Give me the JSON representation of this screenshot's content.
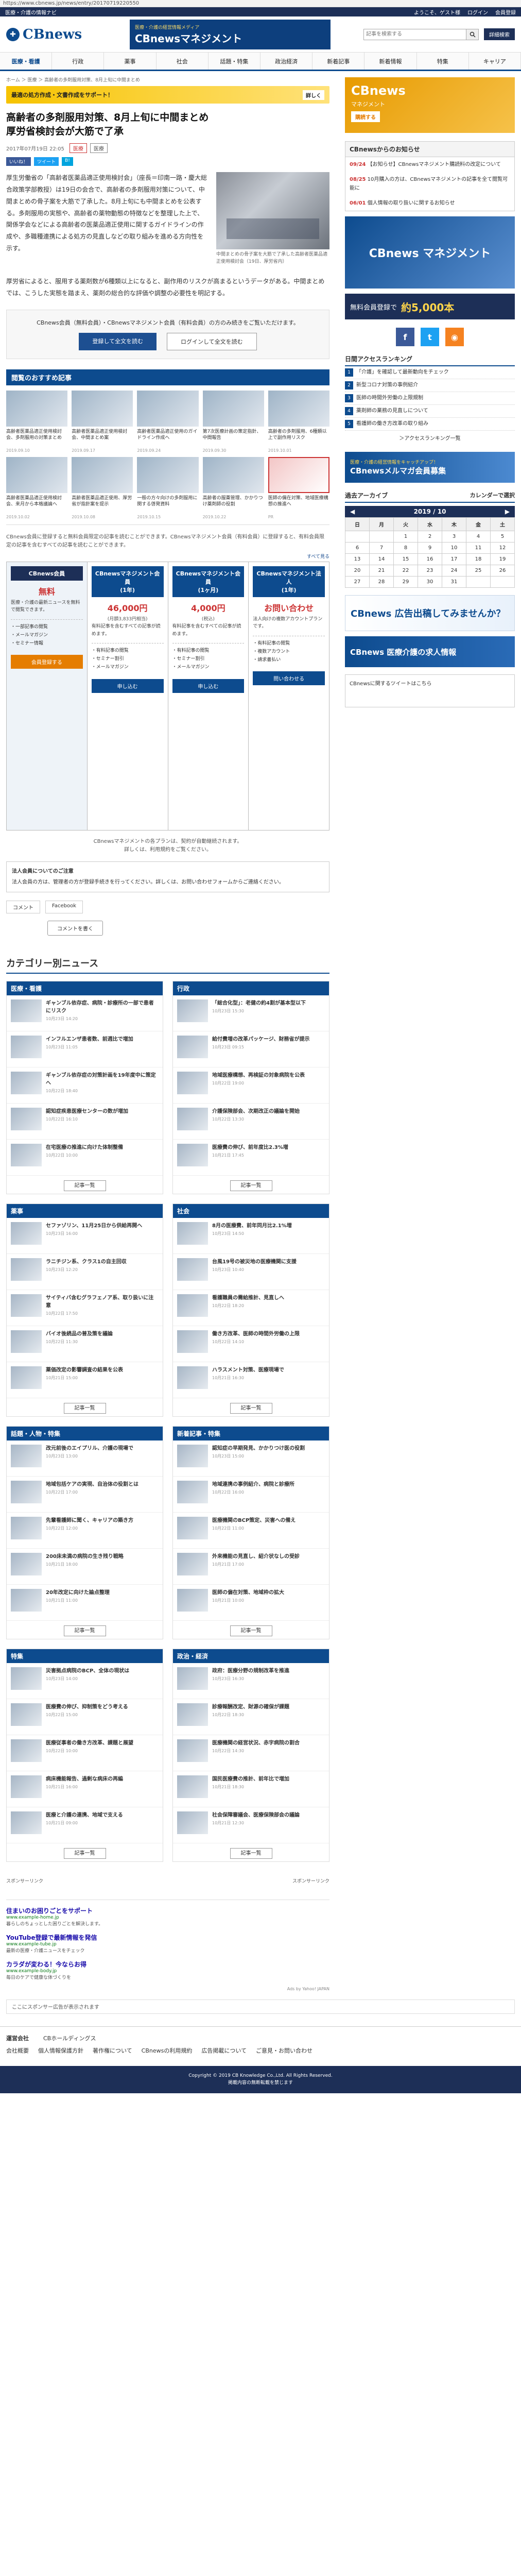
{
  "browser": {
    "url": "https://www.cbnews.jp/news/entry/20170719220550"
  },
  "util_bar": {
    "home": "医療・介護の情報ナビ",
    "welcome": "ようこそ、ゲスト様",
    "login": "ログイン",
    "register": "会員登録"
  },
  "masthead": {
    "logo_text": "CBnews",
    "banner_small": "医療・介護の経営情報メディア",
    "banner_big": "CBnewsマネジメント",
    "search_placeholder": "記事を検索する",
    "register_button": "詳細検索"
  },
  "gnav": [
    "医療・看護",
    "行政",
    "薬事",
    "社会",
    "話題・特集",
    "政治経済",
    "新着記事",
    "新着情報",
    "特集",
    "キャリア"
  ],
  "breadcrumb": "ホーム ＞ 医療 ＞ 高齢者の多剤服用対策、8月上旬に中間まとめ",
  "promo": {
    "text": "最適の処方作成・文書作成をサポート！",
    "button": "詳しく"
  },
  "article": {
    "title": "高齢者の多剤服用対策、8月上旬に中間まとめ\n厚労省検討会が大筋で了承",
    "date": "2017年07月19日 22:05",
    "category": "医療",
    "tag": "医療",
    "share": [
      "いいね！",
      "ツイート",
      "B!"
    ],
    "body1": "厚生労働省の「高齢者医薬品適正使用検討会」（座長＝印南一路・慶大総合政策学部教授）は19日の会合で、高齢者の多剤服用対策について、中間まとめの骨子案を大筋で了承した。8月上旬にも中間まとめを公表する。多剤服用の実態や、高齢者の薬物動態の特徴などを整理した上で、関係学会などによる高齢者の医薬品適正使用に関するガイドラインの作成や、多職種連携による処方の見直しなどの取り組みを進める方向性を示す。",
    "photo_caption": "中間まとめの骨子案を大筋で了承した高齢者医薬品適正使用検討会（19日、厚労省内）",
    "body2": "厚労省によると、服用する薬剤数が6種類以上になると、副作用のリスクが高まるというデータがある。中間まとめでは、こうした実態を踏まえ、薬剤の総合的な評価や調整の必要性を明記する。",
    "member_note": "CBnews会員（無料会員）・CBnewsマネジメント会員（有料会員）の方のみ続きをご覧いただけます。",
    "btn_register": "登録して全文を読む",
    "btn_login": "ログインして全文を読む"
  },
  "recommend": {
    "heading": "閲覧のおすすめ記事",
    "items": [
      {
        "title": "高齢者医薬品適正使用検討会、多剤服用の対策まとめ",
        "date": "2019.09.10"
      },
      {
        "title": "高齢者医薬品適正使用検討会、中間まとめ案",
        "date": "2019.09.17"
      },
      {
        "title": "高齢者医薬品適正使用のガイドライン作成へ",
        "date": "2019.09.24"
      },
      {
        "title": "第7次医療計画の策定指針、中間報告",
        "date": "2019.09.30"
      },
      {
        "title": "高齢者の多剤服用、6種類以上で副作用リスク",
        "date": "2019.10.01"
      },
      {
        "title": "高齢者医薬品適正使用検討会、来月から本格議論へ",
        "date": "2019.10.02"
      },
      {
        "title": "高齢者医薬品適正使用、厚労省が指針案を提示",
        "date": "2019.10.08"
      },
      {
        "title": "一般の方々向けの多剤服用に関する啓発資料",
        "date": "2019.10.15"
      },
      {
        "title": "高齢者の服薬管理、かかりつけ薬剤師の役割",
        "date": "2019.10.22"
      },
      {
        "title": "医師の偏在対策、地域医療構想の推進へ",
        "date": "PR"
      }
    ]
  },
  "plans": {
    "note": "CBnews会員に登録すると無料会員限定の記事を読むことができます。CBnewsマネジメント会員（有料会員）に登録すると、有料会員限定の記事を含むすべての記事を読むことができます。",
    "link": "すべて見る",
    "columns": [
      {
        "name": "CBnews会員",
        "price": "無料",
        "sub": "",
        "desc": "医療・介護の最新ニュースを無料で閲覧できます。",
        "features": "・一部記事の閲覧\n・メールマガジン\n・セミナー情報",
        "button": "会員登録する"
      },
      {
        "name": "CBnewsマネジメント会員\n(1年)",
        "price": "46,000円",
        "sub": "(月額3,833円相当)",
        "desc": "有料記事を含むすべての記事が読めます。",
        "features": "・有料記事の閲覧\n・セミナー割引\n・メールマガジン",
        "button": "申し込む"
      },
      {
        "name": "CBnewsマネジメント会員\n(1ヶ月)",
        "price": "4,000円",
        "sub": "(税込)",
        "desc": "有料記事を含むすべての記事が読めます。",
        "features": "・有料記事の閲覧\n・セミナー割引\n・メールマガジン",
        "button": "申し込む"
      },
      {
        "name": "CBnewsマネジメント法人\n(1年)",
        "price": "お問い合わせ",
        "sub": "",
        "desc": "法人向けの複数アカウントプランです。",
        "features": "・有料記事の閲覧\n・複数アカウント\n・請求書払い",
        "button": "問い合わせる"
      }
    ],
    "footnote": "CBnewsマネジメントの各プランは、契約が自動継続されます。\n詳しくは、利用規約をご覧ください。"
  },
  "notice": {
    "heading": "法人会員についてのご注意",
    "text": "法人会員の方は、管理者の方が登録手続きを行ってください。詳しくは、お問い合わせフォームからご連絡ください。"
  },
  "social": {
    "comment": "コメント",
    "facebook": "Facebook",
    "comment_btn": "コメントを書く"
  },
  "category_news": {
    "title": "カテゴリー別ニュース",
    "boxes": [
      {
        "head": "医療・看護",
        "items": [
          {
            "t": "ギャンブル依存症、病院・診療所の一部で患者にリスク",
            "d": "10月23日 14:20"
          },
          {
            "t": "インフルエンザ患者数、前週比で増加",
            "d": "10月23日 11:05"
          },
          {
            "t": "ギャンブル依存症の対策計画を19年度中に策定へ",
            "d": "10月22日 18:40"
          },
          {
            "t": "認知症疾患医療センターの数が増加",
            "d": "10月22日 16:10"
          },
          {
            "t": "在宅医療の推進に向けた体制整備",
            "d": "10月22日 10:00"
          }
        ]
      },
      {
        "head": "行政",
        "items": [
          {
            "t": "「総合化型」：老健の約4割が基本型以下",
            "d": "10月23日 15:30"
          },
          {
            "t": "給付費増の改革パッケージ、財務省が提示",
            "d": "10月23日 09:15"
          },
          {
            "t": "地域医療構想、再検証の対象病院を公表",
            "d": "10月22日 19:00"
          },
          {
            "t": "介護保険部会、次期改正の議論を開始",
            "d": "10月22日 13:30"
          },
          {
            "t": "医療費の伸び、前年度比2.3%増",
            "d": "10月21日 17:45"
          }
        ]
      },
      {
        "head": "薬事",
        "items": [
          {
            "t": "セファゾリン、11月25日から供給再開へ",
            "d": "10月23日 16:00"
          },
          {
            "t": "ラニチジン系、クラス1の自主回収",
            "d": "10月23日 12:20"
          },
          {
            "t": "サイティバ含むグラフェノア系、取り扱いに注意",
            "d": "10月22日 17:50"
          },
          {
            "t": "バイオ後続品の普及策を議論",
            "d": "10月22日 11:30"
          },
          {
            "t": "薬価改定の影響調査の結果を公表",
            "d": "10月21日 15:00"
          }
        ]
      },
      {
        "head": "社会",
        "items": [
          {
            "t": "8月の医療費、前年同月比2.1%増",
            "d": "10月23日 14:50"
          },
          {
            "t": "台風19号の被災地の医療機関に支援",
            "d": "10月23日 10:40"
          },
          {
            "t": "看護職員の需給推計、見直しへ",
            "d": "10月22日 18:20"
          },
          {
            "t": "働き方改革、医師の時間外労働の上限",
            "d": "10月22日 14:10"
          },
          {
            "t": "ハラスメント対策、医療現場で",
            "d": "10月21日 16:30"
          }
        ]
      },
      {
        "head": "話題・人物・特集",
        "items": [
          {
            "t": "改元前後のエイプリル、介護の現場で",
            "d": "10月23日 13:00"
          },
          {
            "t": "地域包括ケアの実現、自治体の役割とは",
            "d": "10月22日 17:00"
          },
          {
            "t": "先輩看護師に聞く、キャリアの築き方",
            "d": "10月22日 12:00"
          },
          {
            "t": "200床未満の病院の生き残り戦略",
            "d": "10月21日 18:00"
          },
          {
            "t": "20年改定に向けた論点整理",
            "d": "10月21日 11:00"
          }
        ]
      },
      {
        "head": "新着記事・特集",
        "items": [
          {
            "t": "認知症の早期発見、かかりつけ医の役割",
            "d": "10月23日 15:00"
          },
          {
            "t": "地域連携の事例紹介、病院と診療所",
            "d": "10月22日 16:00"
          },
          {
            "t": "医療機関のBCP策定、災害への備え",
            "d": "10月22日 11:00"
          },
          {
            "t": "外来機能の見直し、紹介状なしの受診",
            "d": "10月21日 17:00"
          },
          {
            "t": "医師の偏在対策、地域枠の拡大",
            "d": "10月21日 10:00"
          }
        ]
      },
      {
        "head": "特集",
        "items": [
          {
            "t": "災害拠点病院のBCP、全体の現状は",
            "d": "10月23日 14:00"
          },
          {
            "t": "医療費の伸び、抑制策をどう考える",
            "d": "10月22日 15:00"
          },
          {
            "t": "医療従事者の働き方改革、課題と展望",
            "d": "10月22日 10:00"
          },
          {
            "t": "病床機能報告、過剰な病床の再編",
            "d": "10月21日 16:00"
          },
          {
            "t": "医療と介護の連携、地域で支える",
            "d": "10月21日 09:00"
          }
        ]
      },
      {
        "head": "政治・経済",
        "items": [
          {
            "t": "政府：医療分野の規制改革を推進",
            "d": "10月23日 16:30"
          },
          {
            "t": "診療報酬改定、財源の確保が課題",
            "d": "10月22日 18:30"
          },
          {
            "t": "医療機関の経営状況、赤字病院の割合",
            "d": "10月22日 14:30"
          },
          {
            "t": "国民医療費の推計、前年比で増加",
            "d": "10月21日 18:30"
          },
          {
            "t": "社会保障審議会、医療保険部会の議論",
            "d": "10月21日 12:30"
          }
        ]
      }
    ],
    "more": "記事一覧"
  },
  "ad_notes": {
    "left": "スポンサーリンク",
    "right": "スポンサーリンク"
  },
  "text_ads": [
    {
      "t": "住まいのお困りごとをサポート",
      "u": "www.example-home.jp",
      "s": "暮らしのちょっとした困りごとを解決します。"
    },
    {
      "t": "YouTube登録で最新情報を発信",
      "u": "www.example-tube.jp",
      "s": "最新の医療・介護ニュースをチェック"
    },
    {
      "t": "カラダが変わる！今ならお得",
      "u": "www.example-body.jp",
      "s": "毎日のケアで健康な体づくりを"
    }
  ],
  "ads_by": "Ads by Yahoo! JAPAN",
  "sidebar": {
    "banner_top": {
      "big": "CBnews",
      "sub": "マネジメント",
      "btn": "購読する"
    },
    "news_head": "CBnewsからのお知らせ",
    "news": [
      {
        "d": "09/24",
        "t": "【お知らせ】CBnewsマネジメント購読料の改定について"
      },
      {
        "d": "08/25",
        "t": "10月購入の方は、CBnewsマネジメントの記事を全て閲覧可能に"
      },
      {
        "d": "06/01",
        "t": "個人情報の取り扱いに関するお知らせ"
      }
    ],
    "mm": "CBnews マネジメント",
    "free": {
      "text": "無料会員登録で",
      "yen": "約5,000本"
    },
    "rank_head": "日間アクセスランキング",
    "ranks": [
      "「介護」を確認して最新動向をチェック",
      "新型コロナ対策の事例紹介",
      "医師の時間外労働の上限規制",
      "薬剤師の業務の見直しについて",
      "看護師の働き方改革の取り組み"
    ],
    "rank_more": "＞アクセスランキング一覧",
    "mm_banner": {
      "s": "医療・介護の経営情報をキャッチアップ！",
      "b": "CBnewsメルマガ会員募集"
    },
    "archive_head": "過去アーカイブ",
    "archive_icon": "カレンダーで選択",
    "cal_month": "2019 / 10",
    "cal_days": [
      "日",
      "月",
      "火",
      "水",
      "木",
      "金",
      "土"
    ],
    "cal_rows": [
      [
        "",
        "",
        "1",
        "2",
        "3",
        "4",
        "5"
      ],
      [
        "6",
        "7",
        "8",
        "9",
        "10",
        "11",
        "12"
      ],
      [
        "13",
        "14",
        "15",
        "16",
        "17",
        "18",
        "19"
      ],
      [
        "20",
        "21",
        "22",
        "23",
        "24",
        "25",
        "26"
      ],
      [
        "27",
        "28",
        "29",
        "30",
        "31",
        "",
        ""
      ]
    ],
    "ad1": "CBnews 広告出稿してみませんか？",
    "ad2": "CBnews 医療介護の求人情報",
    "tw": "CBnewsに関するツイートはこちら"
  },
  "bottom_ad": "ここにスポンサー広告が表示されます",
  "footer": {
    "row1_head": "運営会社",
    "row1": [
      "CBホールディングス"
    ],
    "row2": [
      "会社概要",
      "個人情報保護方針",
      "著作権について",
      "CBnewsの利用規約",
      "広告掲載について",
      "ご意見・お問い合わせ"
    ],
    "copyright": "Copyright © 2019 CB Knowledge Co.,Ltd. All Rights Reserved.",
    "copyright2": "掲載内容の無断転載を禁じます"
  }
}
